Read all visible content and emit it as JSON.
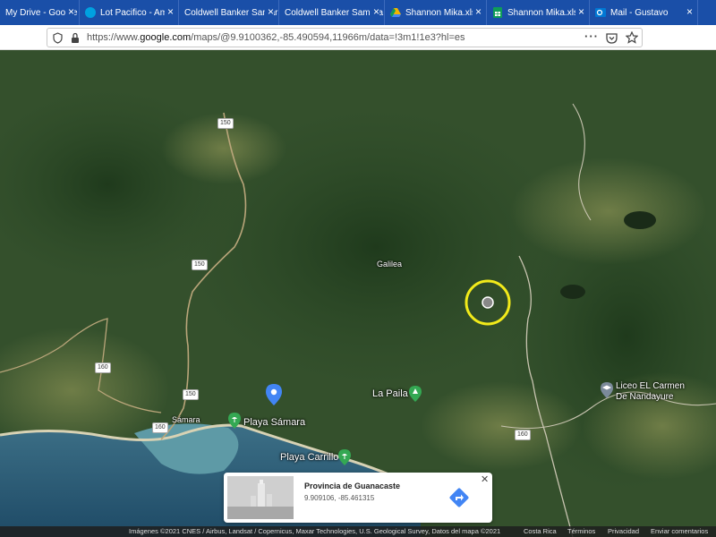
{
  "tabs": [
    {
      "label": "My Drive - Google Drive",
      "icon": "drive-icon",
      "color": "#1a4fa8"
    },
    {
      "label": "Lot Pacifico - Am",
      "icon": "cloud-icon",
      "color": "#00a1e0"
    },
    {
      "label": "Coldwell Banker Samara",
      "icon": "blank-icon",
      "color": "#1a4fa8"
    },
    {
      "label": "Coldwell Banker Samara",
      "icon": "blank-icon",
      "color": "#1a4fa8"
    },
    {
      "label": "Shannon Mika.xlsx",
      "icon": "drive-icon",
      "color": "#f4b400"
    },
    {
      "label": "Shannon Mika.xlsx",
      "icon": "sheets-icon",
      "color": "#0f9d58"
    },
    {
      "label": "Mail - Gustavo",
      "icon": "outlook-icon",
      "color": "#0078d4"
    }
  ],
  "url": {
    "prefix": "https://www.",
    "domain": "google.com",
    "path": "/maps/@9.9100362,-85.490594,11966m/data=!3m1!1e3?hl=es"
  },
  "map": {
    "places": [
      "Galilea",
      "Sámara"
    ],
    "pois": [
      "Playa Sámara",
      "Playa Carrillo",
      "La Paila"
    ],
    "school": {
      "line1": "Liceo EL Carmen",
      "line2": "De Nandayure"
    },
    "roads": [
      "150",
      "150",
      "160",
      "150",
      "160",
      "160"
    ]
  },
  "card": {
    "title": "Provincia de Guanacaste",
    "coords": "9.909106, -85.461315"
  },
  "footer": {
    "attribution": "Imágenes ©2021 CNES / Airbus, Landsat / Copernicus, Maxar Technologies, U.S. Geological Survey, Datos del mapa ©2021",
    "country": "Costa Rica",
    "terms": "Términos",
    "privacy": "Privacidad",
    "feedback": "Enviar comentarios"
  },
  "colors": {
    "tabbar": "#1a4fa8",
    "highlight_ring": "#f2ea1a",
    "pin": "#4285f4",
    "poi_green": "#34a853"
  }
}
